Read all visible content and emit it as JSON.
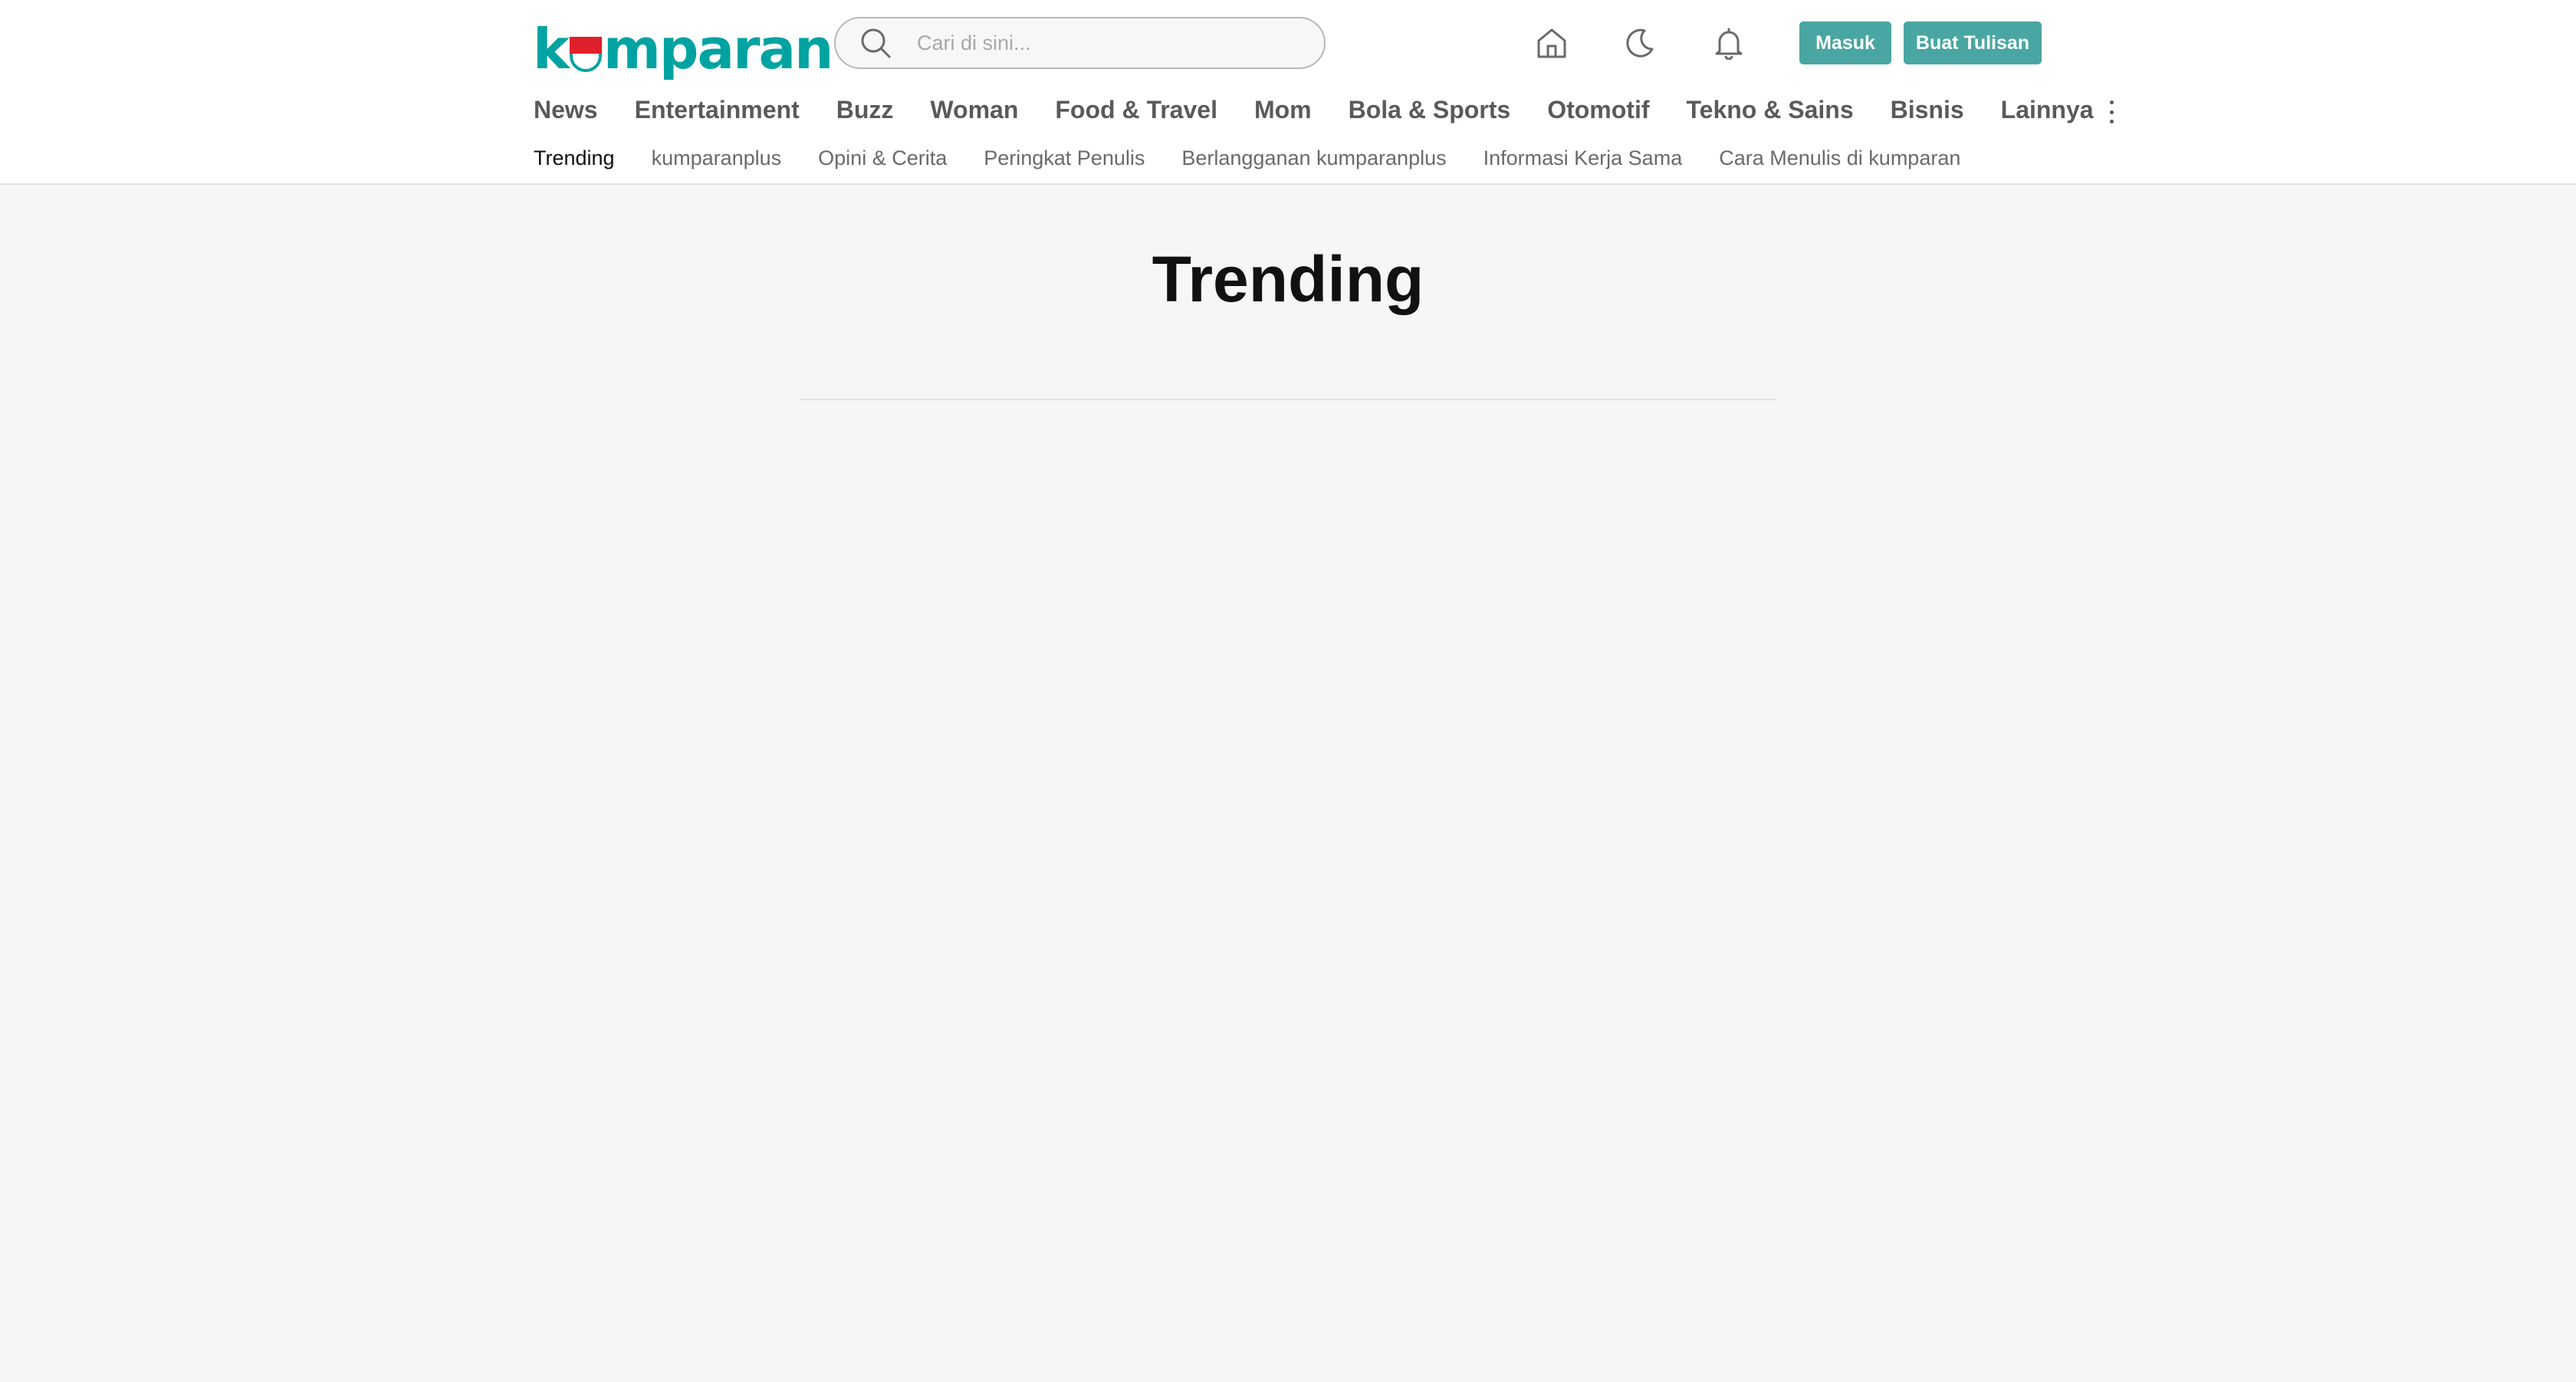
{
  "header": {
    "logo_text_k": "k",
    "logo_text_rest": "mparan",
    "search": {
      "placeholder": "Cari di sini..."
    },
    "icons": [
      "search-icon",
      "home-icon",
      "moon-icon",
      "bell-icon",
      "more-vertical-icon"
    ],
    "login_label": "Masuk",
    "write_label": "Buat Tulisan",
    "accent_color": "#4aa6a2"
  },
  "nav": {
    "items": [
      "News",
      "Entertainment",
      "Buzz",
      "Woman",
      "Food & Travel",
      "Mom",
      "Bola & Sports",
      "Otomotif",
      "Tekno & Sains",
      "Bisnis",
      "Lainnya"
    ]
  },
  "subnav": {
    "items": [
      "Trending",
      "kumparanplus",
      "Opini & Cerita",
      "Peringkat Penulis",
      "Berlangganan kumparanplus",
      "Informasi Kerja Sama",
      "Cara Menulis di kumparan"
    ],
    "active": "Trending"
  },
  "main": {
    "title": "Trending"
  }
}
